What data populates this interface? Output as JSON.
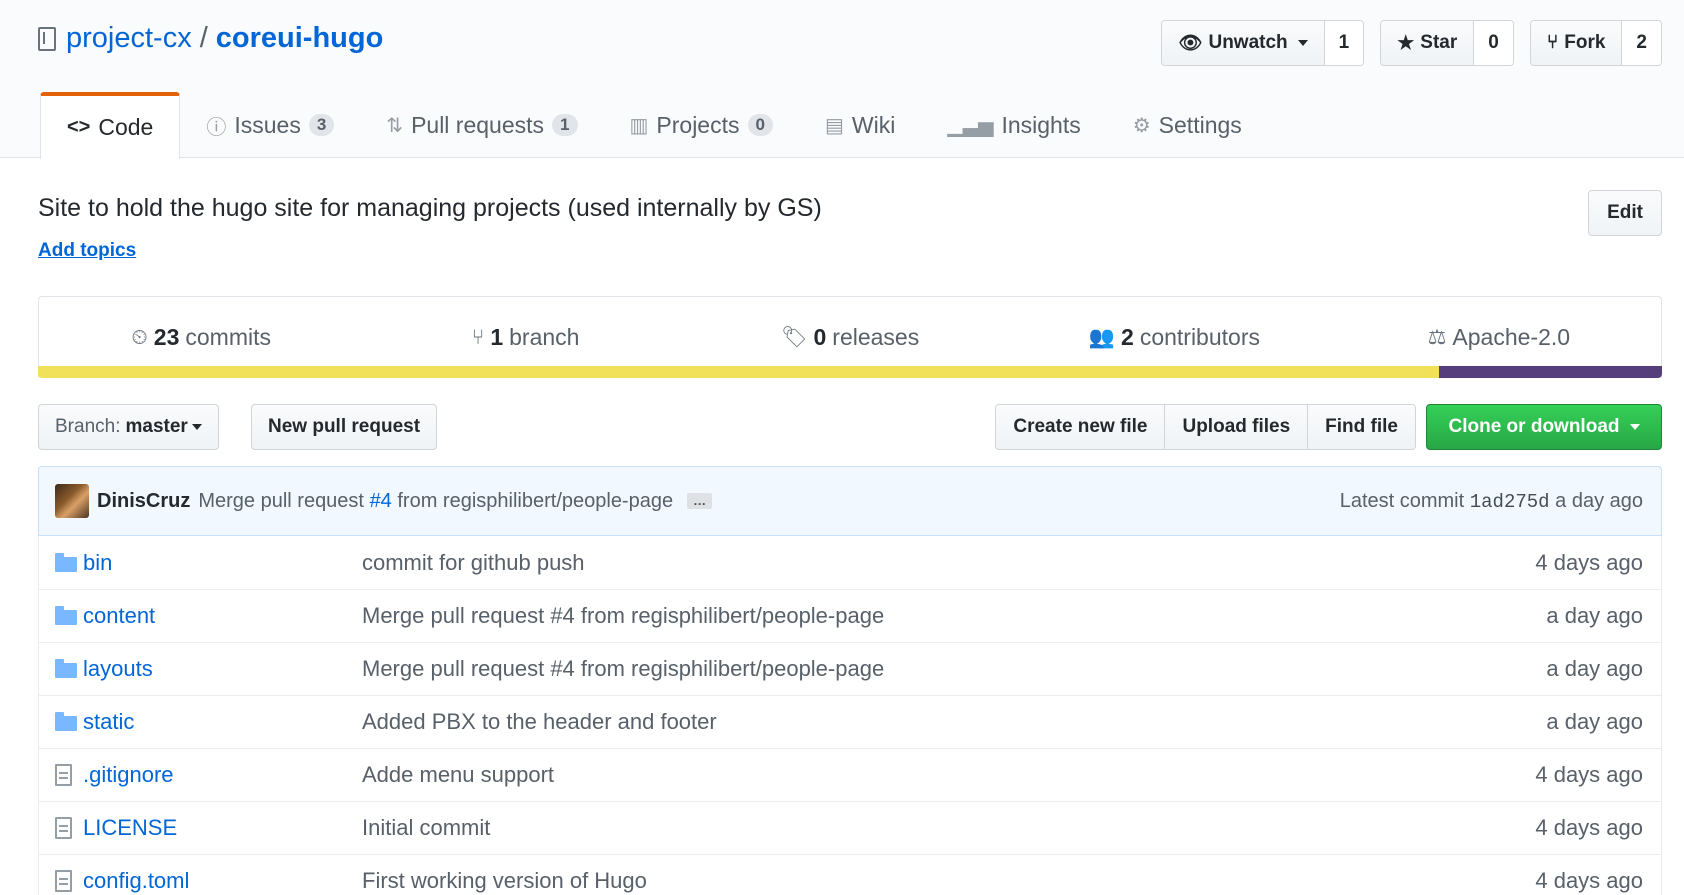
{
  "repo": {
    "owner": "project-cx",
    "separator": "/",
    "name": "coreui-hugo"
  },
  "actions": {
    "unwatch_label": "Unwatch",
    "unwatch_count": "1",
    "star_label": "Star",
    "star_count": "0",
    "fork_label": "Fork",
    "fork_count": "2"
  },
  "tabs": [
    {
      "label": "Code",
      "icon": "code-icon",
      "counter": null,
      "selected": true
    },
    {
      "label": "Issues",
      "icon": "issue-icon",
      "counter": "3"
    },
    {
      "label": "Pull requests",
      "icon": "pull-request-icon",
      "counter": "1"
    },
    {
      "label": "Projects",
      "icon": "project-icon",
      "counter": "0"
    },
    {
      "label": "Wiki",
      "icon": "book-icon",
      "counter": null
    },
    {
      "label": "Insights",
      "icon": "graph-icon",
      "counter": null
    },
    {
      "label": "Settings",
      "icon": "gear-icon",
      "counter": null
    }
  ],
  "description": {
    "text": "Site to hold the hugo site for managing projects (used internally by GS)",
    "add_topics": "Add topics",
    "edit_label": "Edit"
  },
  "summary": {
    "commits_count": "23",
    "commits_label": "commits",
    "branch_count": "1",
    "branch_label": "branch",
    "releases_count": "0",
    "releases_label": "releases",
    "contributors_count": "2",
    "contributors_label": "contributors",
    "license": "Apache-2.0"
  },
  "language_colors": {
    "primary": "#f1e05a",
    "secondary": "#563d7c"
  },
  "filenav": {
    "branch_prefix": "Branch:",
    "branch_name": "master",
    "new_pull_request": "New pull request",
    "create_new_file": "Create new file",
    "upload_files": "Upload files",
    "find_file": "Find file",
    "clone_or_download": "Clone or download"
  },
  "latest_commit": {
    "author": "DinisCruz",
    "message_prefix": "Merge pull request",
    "pr_link": "#4",
    "message_suffix": "from regisphilibert/people-page",
    "ellipsis": "…",
    "meta_label": "Latest commit",
    "sha": "1ad275d",
    "age": "a day ago"
  },
  "files": [
    {
      "type": "folder",
      "name": "bin",
      "message": "commit for github push",
      "age": "4 days ago"
    },
    {
      "type": "folder",
      "name": "content",
      "message": "Merge pull request #4 from regisphilibert/people-page",
      "age": "a day ago"
    },
    {
      "type": "folder",
      "name": "layouts",
      "message": "Merge pull request #4 from regisphilibert/people-page",
      "age": "a day ago"
    },
    {
      "type": "folder",
      "name": "static",
      "message": "Added PBX to the header and footer",
      "age": "a day ago"
    },
    {
      "type": "file",
      "name": ".gitignore",
      "message": "Adde menu support",
      "age": "4 days ago"
    },
    {
      "type": "file",
      "name": "LICENSE",
      "message": "Initial commit",
      "age": "4 days ago"
    },
    {
      "type": "file",
      "name": "config.toml",
      "message": "First working version of Hugo",
      "age": "4 days ago"
    }
  ]
}
